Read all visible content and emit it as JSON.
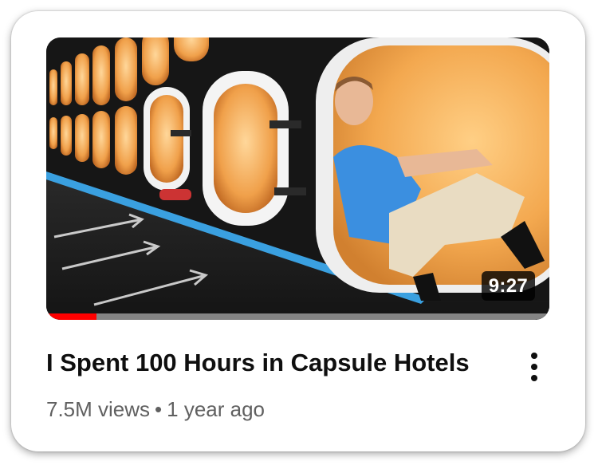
{
  "video": {
    "title": "I Spent 100 Hours in Capsule Hotels",
    "views": "7.5M views",
    "separator": "•",
    "age": "1 year ago",
    "duration": "9:27",
    "watch_progress_percent": 10,
    "thumbnail_icon": "capsule-hotel-thumbnail"
  },
  "actions": {
    "more_icon": "vertical-ellipsis-icon"
  },
  "colors": {
    "progress": "#ff0000",
    "title": "#0f0f0f",
    "meta": "#606060"
  }
}
